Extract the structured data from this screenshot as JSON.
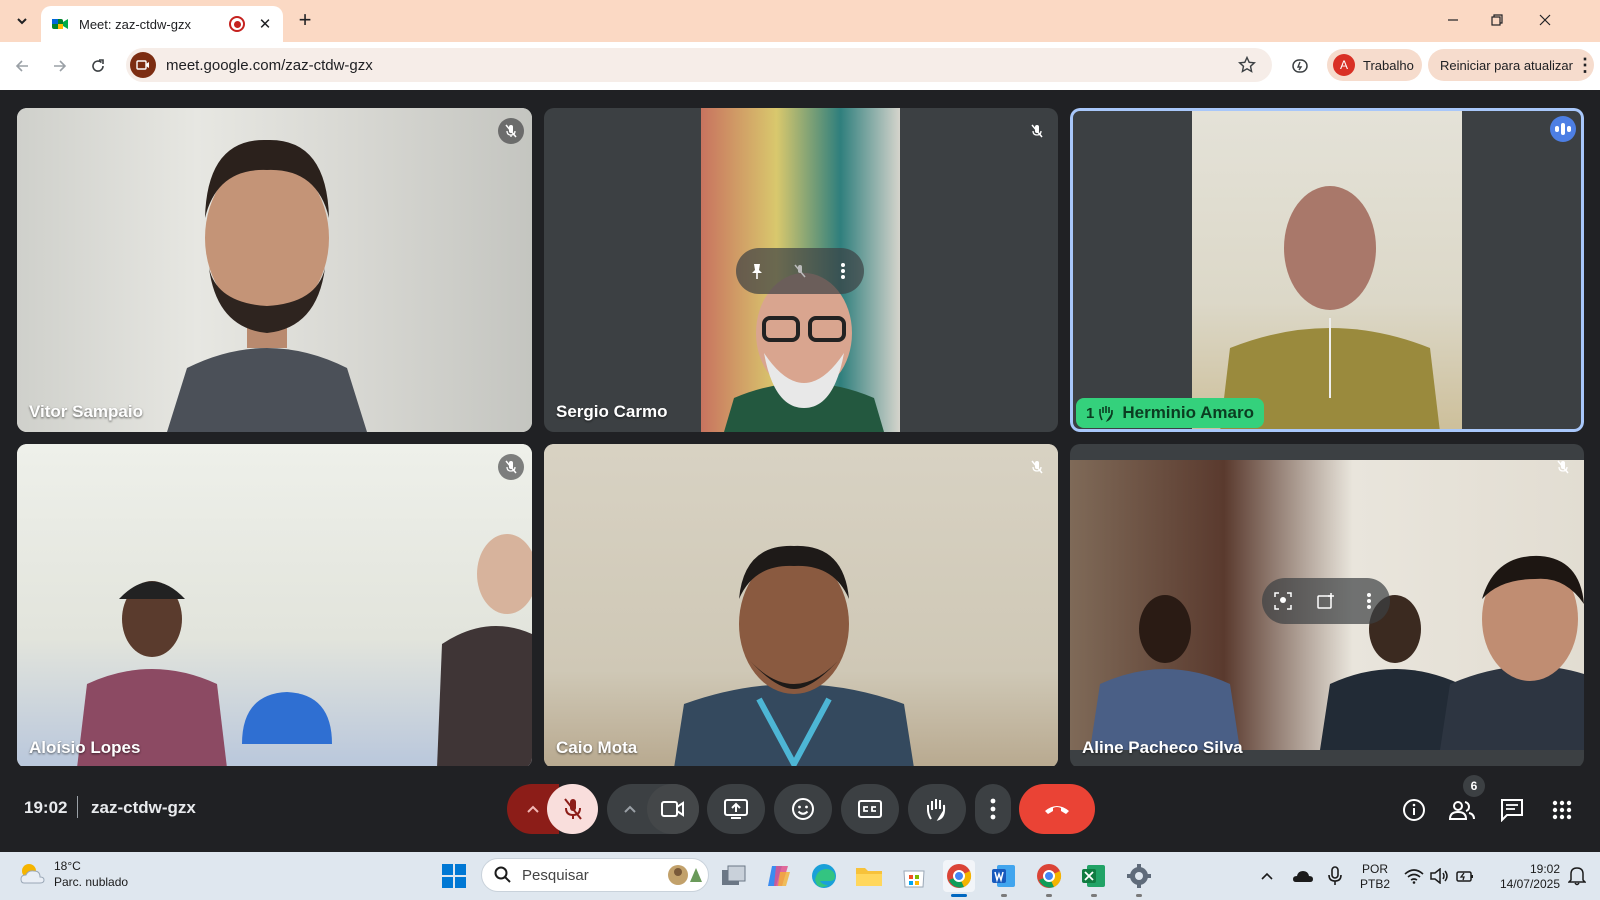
{
  "browser": {
    "tab_title": "Meet: zaz-ctdw-gzx",
    "url": "meet.google.com/zaz-ctdw-gzx",
    "profile_initial": "A",
    "profile_label": "Trabalho",
    "update_label": "Reiniciar para atualizar"
  },
  "participants": [
    {
      "name": "Vitor Sampaio"
    },
    {
      "name": "Sergio Carmo"
    },
    {
      "name": "Herminio Amaro",
      "hand_count": "1"
    },
    {
      "name": "Aloísio Lopes"
    },
    {
      "name": "Caio Mota"
    },
    {
      "name": "Aline Pacheco Silva"
    }
  ],
  "meeting": {
    "time": "19:02",
    "code": "zaz-ctdw-gzx",
    "people_count": "6"
  },
  "taskbar": {
    "temperature": "18°C",
    "condition": "Parc. nublado",
    "search_placeholder": "Pesquisar",
    "lang_line1": "POR",
    "lang_line2": "PTB2",
    "clock_time": "19:02",
    "clock_date": "14/07/2025"
  },
  "colors": {
    "tab_strip": "#fbd9c4",
    "meet_bg": "#202124",
    "tile_bg": "#3c4043",
    "end_call": "#ea4335",
    "hand_raise": "#34d17c",
    "active_speaker": "#a8c7fa"
  }
}
